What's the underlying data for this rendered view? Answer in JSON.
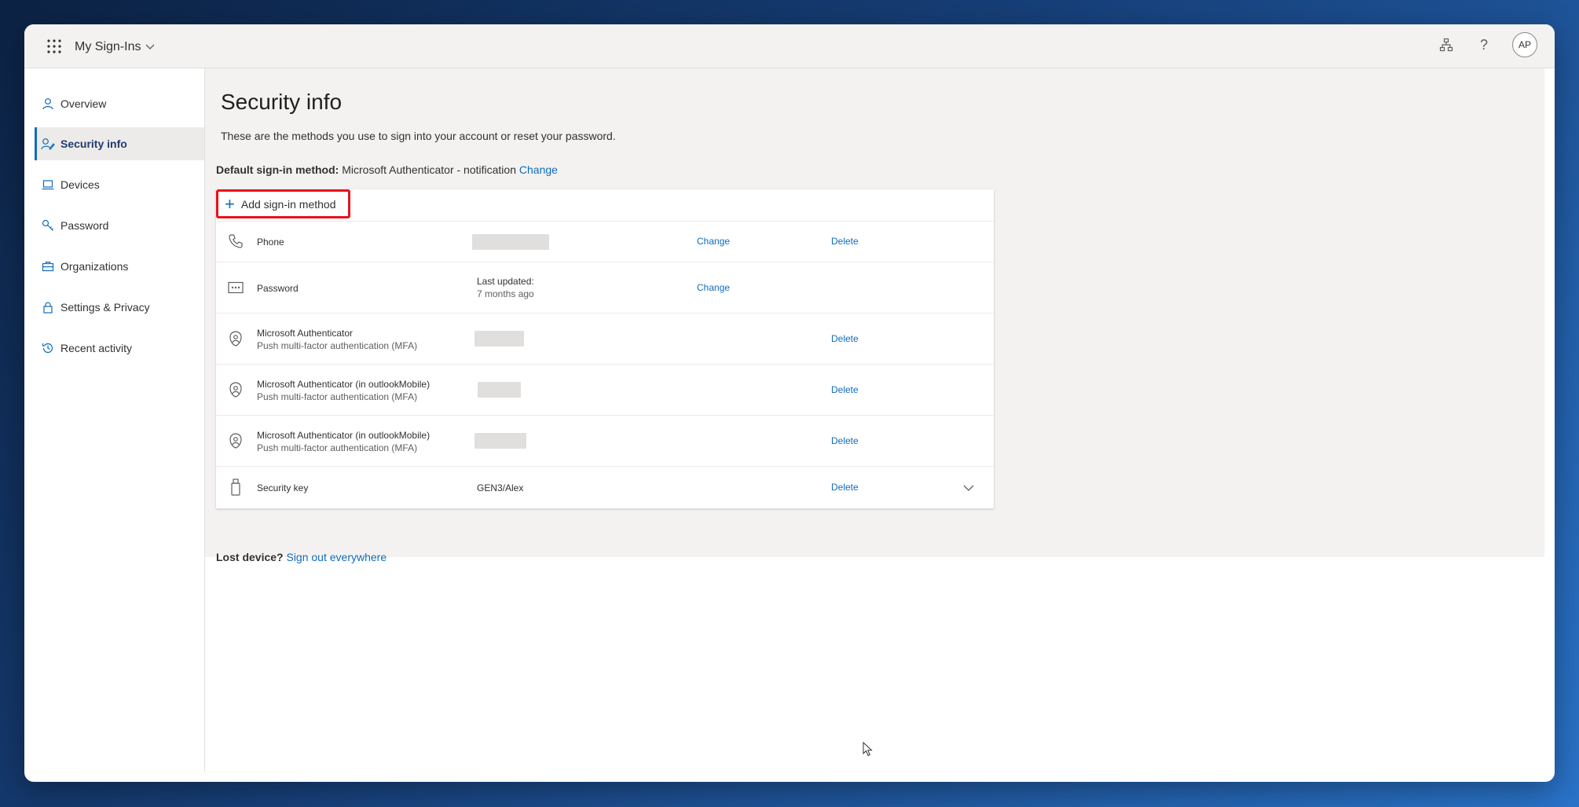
{
  "app": {
    "title": "My Sign-Ins"
  },
  "header": {
    "avatar_initials": "AP"
  },
  "sidebar": {
    "items": [
      {
        "label": "Overview",
        "icon": "person-icon",
        "active": false
      },
      {
        "label": "Security info",
        "icon": "security-info-icon",
        "active": true
      },
      {
        "label": "Devices",
        "icon": "laptop-icon",
        "active": false
      },
      {
        "label": "Password",
        "icon": "key-icon",
        "active": false
      },
      {
        "label": "Organizations",
        "icon": "briefcase-icon",
        "active": false
      },
      {
        "label": "Settings & Privacy",
        "icon": "lock-icon",
        "active": false
      },
      {
        "label": "Recent activity",
        "icon": "history-icon",
        "active": false
      }
    ]
  },
  "main": {
    "title": "Security info",
    "description": "These are the methods you use to sign into your account or reset your password.",
    "default_method": {
      "label": "Default sign-in method:",
      "value": "Microsoft Authenticator - notification",
      "change_label": "Change"
    },
    "add_method_label": "Add sign-in method",
    "methods": [
      {
        "icon": "phone-icon",
        "name": "Phone",
        "subtitle": "",
        "detail": "",
        "detail_masked": true,
        "change": "Change",
        "delete": "Delete"
      },
      {
        "icon": "password-dots-icon",
        "name": "Password",
        "subtitle": "",
        "detail": "Last updated:",
        "detail_sub": "7 months ago",
        "change": "Change",
        "delete": ""
      },
      {
        "icon": "authenticator-icon",
        "name": "Microsoft Authenticator",
        "subtitle": "Push multi-factor authentication (MFA)",
        "detail_masked": true,
        "change": "",
        "delete": "Delete"
      },
      {
        "icon": "authenticator-icon",
        "name": "Microsoft Authenticator (in outlookMobile)",
        "subtitle": "Push multi-factor authentication (MFA)",
        "detail_masked": true,
        "change": "",
        "delete": "Delete"
      },
      {
        "icon": "authenticator-icon",
        "name": "Microsoft Authenticator (in outlookMobile)",
        "subtitle": "Push multi-factor authentication (MFA)",
        "detail_masked": true,
        "change": "",
        "delete": "Delete"
      },
      {
        "icon": "security-key-icon",
        "name": "Security key",
        "subtitle": "",
        "detail": "GEN3/Alex",
        "change": "",
        "delete": "Delete",
        "expandable": true
      }
    ],
    "lost_device": {
      "label": "Lost device?",
      "link": "Sign out everywhere"
    }
  },
  "colors": {
    "accent": "#0f6cbd",
    "highlight": "#e8131d",
    "background": "#f3f2f1"
  }
}
